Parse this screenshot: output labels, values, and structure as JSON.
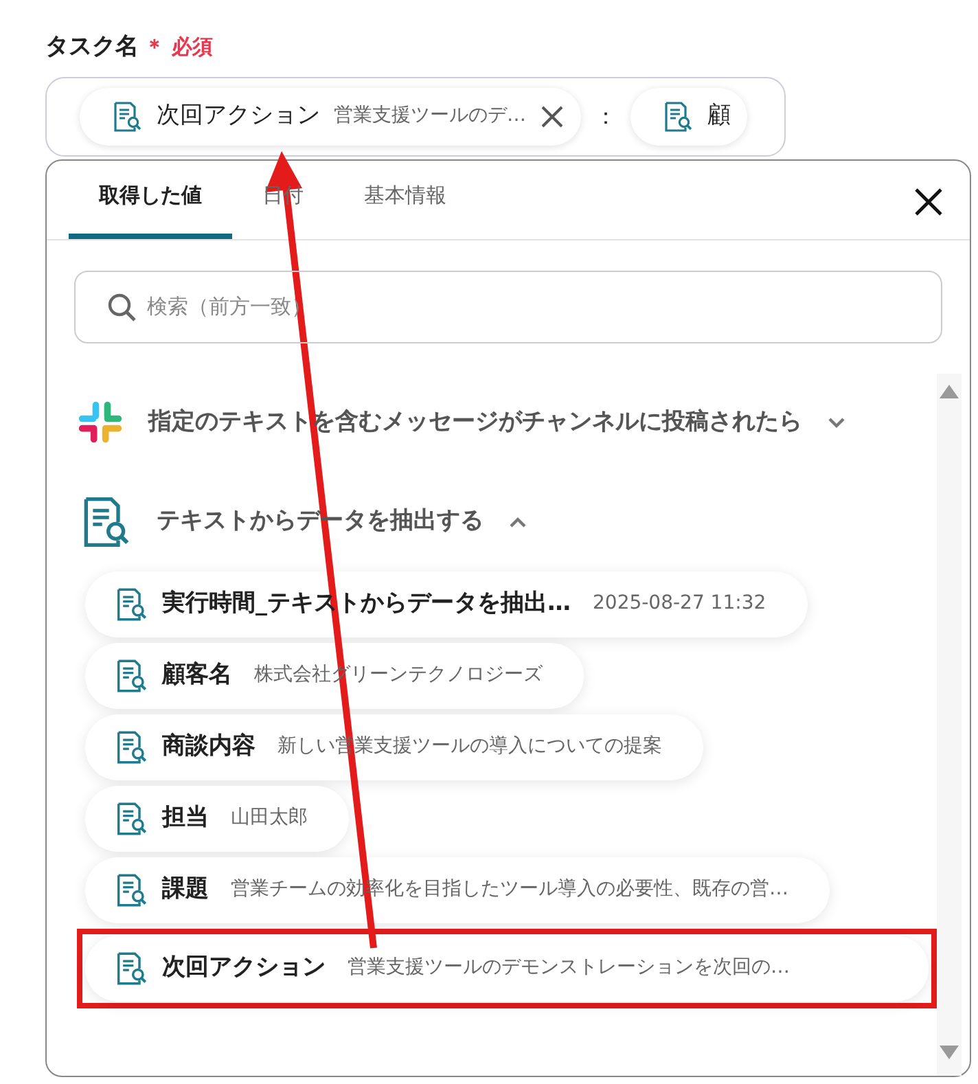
{
  "field": {
    "label": "タスク名",
    "required_mark": "＊",
    "required_text": "必須",
    "chips": [
      {
        "label": "次回アクション",
        "value": "営業支援ツールのデ…",
        "removable": true
      },
      {
        "label": "顧",
        "removable": false
      }
    ],
    "separator": "："
  },
  "dialog": {
    "tabs": [
      {
        "label": "取得した値",
        "selected": true
      },
      {
        "label": "日付",
        "selected": false
      },
      {
        "label": "基本情報",
        "selected": false
      }
    ],
    "search": {
      "placeholder": "検索（前方一致）"
    },
    "groups": [
      {
        "kind": "slack",
        "title": "指定のテキストを含むメッセージがチャンネルに投稿されたら",
        "expanded": false
      },
      {
        "kind": "doc",
        "title": "テキストからデータを抽出する",
        "expanded": true,
        "items": [
          {
            "label": "実行時間_テキストからデータを抽出…",
            "value": "2025-08-27 11:32",
            "highlighted": false
          },
          {
            "label": "顧客名",
            "value": "株式会社グリーンテクノロジーズ",
            "highlighted": false
          },
          {
            "label": "商談内容",
            "value": "新しい営業支援ツールの導入についての提案",
            "highlighted": false
          },
          {
            "label": "担当",
            "value": "山田太郎",
            "highlighted": false
          },
          {
            "label": "課題",
            "value": "営業チームの効率化を目指したツール導入の必要性、既存の営…",
            "highlighted": false
          },
          {
            "label": "次回アクション",
            "value": "営業支援ツールのデモンストレーションを次回の…",
            "highlighted": true
          }
        ]
      }
    ]
  }
}
